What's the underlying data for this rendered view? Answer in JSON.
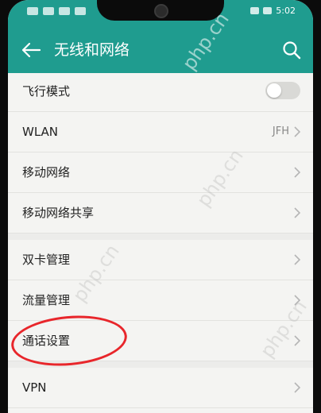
{
  "status_bar": {
    "time": "5:02"
  },
  "header": {
    "title": "无线和网络"
  },
  "settings": {
    "items": [
      {
        "label": "飞行模式",
        "value": ""
      },
      {
        "label": "WLAN",
        "value": "JFH"
      },
      {
        "label": "移动网络",
        "value": ""
      },
      {
        "label": "移动网络共享",
        "value": ""
      },
      {
        "label": "双卡管理",
        "value": ""
      },
      {
        "label": "流量管理",
        "value": ""
      },
      {
        "label": "通话设置",
        "value": ""
      },
      {
        "label": "VPN",
        "value": ""
      }
    ]
  },
  "watermark": {
    "text": "php.cn"
  },
  "colors": {
    "accent": "#1f9c8f",
    "annotation": "#e8262b"
  },
  "airplane_mode_on": false
}
